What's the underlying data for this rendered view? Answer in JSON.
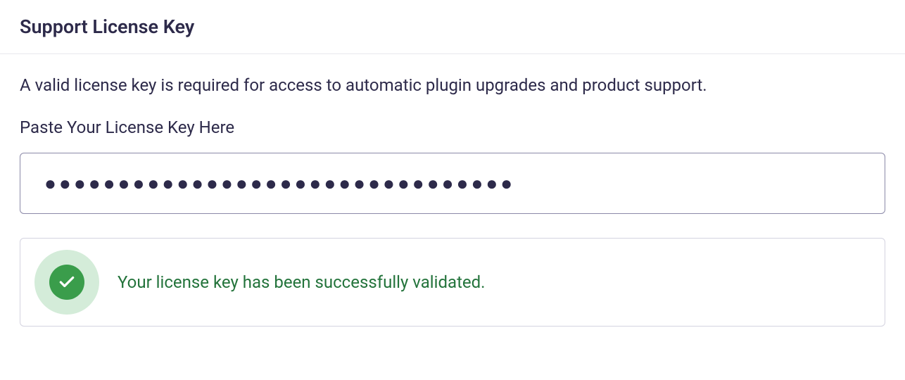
{
  "header": {
    "title": "Support License Key"
  },
  "content": {
    "description": "A valid license key is required for access to automatic plugin upgrades and product support.",
    "license_field": {
      "label": "Paste Your License Key Here",
      "value": "●●●●●●●●●●●●●●●●●●●●●●●●●●●●●●●●"
    },
    "status": {
      "message": "Your license key has been successfully validated."
    }
  }
}
